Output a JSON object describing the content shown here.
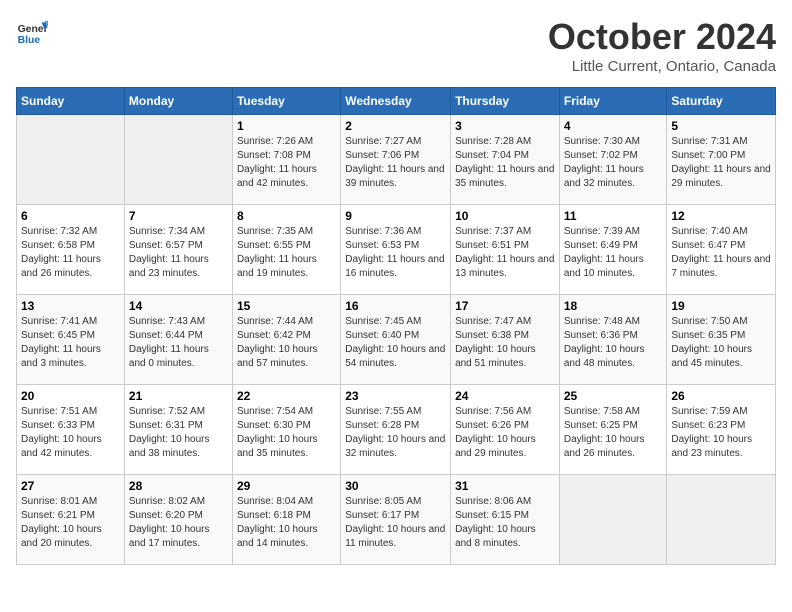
{
  "header": {
    "logo": {
      "general": "General",
      "blue": "Blue"
    },
    "title": "October 2024",
    "location": "Little Current, Ontario, Canada"
  },
  "weekdays": [
    "Sunday",
    "Monday",
    "Tuesday",
    "Wednesday",
    "Thursday",
    "Friday",
    "Saturday"
  ],
  "weeks": [
    [
      {
        "day": null
      },
      {
        "day": null
      },
      {
        "day": 1,
        "sunrise": "7:26 AM",
        "sunset": "7:08 PM",
        "daylight": "11 hours and 42 minutes."
      },
      {
        "day": 2,
        "sunrise": "7:27 AM",
        "sunset": "7:06 PM",
        "daylight": "11 hours and 39 minutes."
      },
      {
        "day": 3,
        "sunrise": "7:28 AM",
        "sunset": "7:04 PM",
        "daylight": "11 hours and 35 minutes."
      },
      {
        "day": 4,
        "sunrise": "7:30 AM",
        "sunset": "7:02 PM",
        "daylight": "11 hours and 32 minutes."
      },
      {
        "day": 5,
        "sunrise": "7:31 AM",
        "sunset": "7:00 PM",
        "daylight": "11 hours and 29 minutes."
      }
    ],
    [
      {
        "day": 6,
        "sunrise": "7:32 AM",
        "sunset": "6:58 PM",
        "daylight": "11 hours and 26 minutes."
      },
      {
        "day": 7,
        "sunrise": "7:34 AM",
        "sunset": "6:57 PM",
        "daylight": "11 hours and 23 minutes."
      },
      {
        "day": 8,
        "sunrise": "7:35 AM",
        "sunset": "6:55 PM",
        "daylight": "11 hours and 19 minutes."
      },
      {
        "day": 9,
        "sunrise": "7:36 AM",
        "sunset": "6:53 PM",
        "daylight": "11 hours and 16 minutes."
      },
      {
        "day": 10,
        "sunrise": "7:37 AM",
        "sunset": "6:51 PM",
        "daylight": "11 hours and 13 minutes."
      },
      {
        "day": 11,
        "sunrise": "7:39 AM",
        "sunset": "6:49 PM",
        "daylight": "11 hours and 10 minutes."
      },
      {
        "day": 12,
        "sunrise": "7:40 AM",
        "sunset": "6:47 PM",
        "daylight": "11 hours and 7 minutes."
      }
    ],
    [
      {
        "day": 13,
        "sunrise": "7:41 AM",
        "sunset": "6:45 PM",
        "daylight": "11 hours and 3 minutes."
      },
      {
        "day": 14,
        "sunrise": "7:43 AM",
        "sunset": "6:44 PM",
        "daylight": "11 hours and 0 minutes."
      },
      {
        "day": 15,
        "sunrise": "7:44 AM",
        "sunset": "6:42 PM",
        "daylight": "10 hours and 57 minutes."
      },
      {
        "day": 16,
        "sunrise": "7:45 AM",
        "sunset": "6:40 PM",
        "daylight": "10 hours and 54 minutes."
      },
      {
        "day": 17,
        "sunrise": "7:47 AM",
        "sunset": "6:38 PM",
        "daylight": "10 hours and 51 minutes."
      },
      {
        "day": 18,
        "sunrise": "7:48 AM",
        "sunset": "6:36 PM",
        "daylight": "10 hours and 48 minutes."
      },
      {
        "day": 19,
        "sunrise": "7:50 AM",
        "sunset": "6:35 PM",
        "daylight": "10 hours and 45 minutes."
      }
    ],
    [
      {
        "day": 20,
        "sunrise": "7:51 AM",
        "sunset": "6:33 PM",
        "daylight": "10 hours and 42 minutes."
      },
      {
        "day": 21,
        "sunrise": "7:52 AM",
        "sunset": "6:31 PM",
        "daylight": "10 hours and 38 minutes."
      },
      {
        "day": 22,
        "sunrise": "7:54 AM",
        "sunset": "6:30 PM",
        "daylight": "10 hours and 35 minutes."
      },
      {
        "day": 23,
        "sunrise": "7:55 AM",
        "sunset": "6:28 PM",
        "daylight": "10 hours and 32 minutes."
      },
      {
        "day": 24,
        "sunrise": "7:56 AM",
        "sunset": "6:26 PM",
        "daylight": "10 hours and 29 minutes."
      },
      {
        "day": 25,
        "sunrise": "7:58 AM",
        "sunset": "6:25 PM",
        "daylight": "10 hours and 26 minutes."
      },
      {
        "day": 26,
        "sunrise": "7:59 AM",
        "sunset": "6:23 PM",
        "daylight": "10 hours and 23 minutes."
      }
    ],
    [
      {
        "day": 27,
        "sunrise": "8:01 AM",
        "sunset": "6:21 PM",
        "daylight": "10 hours and 20 minutes."
      },
      {
        "day": 28,
        "sunrise": "8:02 AM",
        "sunset": "6:20 PM",
        "daylight": "10 hours and 17 minutes."
      },
      {
        "day": 29,
        "sunrise": "8:04 AM",
        "sunset": "6:18 PM",
        "daylight": "10 hours and 14 minutes."
      },
      {
        "day": 30,
        "sunrise": "8:05 AM",
        "sunset": "6:17 PM",
        "daylight": "10 hours and 11 minutes."
      },
      {
        "day": 31,
        "sunrise": "8:06 AM",
        "sunset": "6:15 PM",
        "daylight": "10 hours and 8 minutes."
      },
      {
        "day": null
      },
      {
        "day": null
      }
    ]
  ]
}
